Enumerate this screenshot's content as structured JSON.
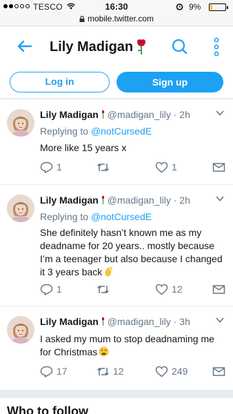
{
  "status_bar": {
    "carrier": "TESCO",
    "time": "16:30",
    "battery_percent": "9%",
    "battery_level": 0.09,
    "icons": [
      "signal-dots-icon",
      "wifi-icon",
      "alarm-icon",
      "battery-icon"
    ]
  },
  "browser": {
    "url": "mobile.twitter.com",
    "icon": "lock-icon"
  },
  "header": {
    "title": "Lily Madigan",
    "title_emoji": "rose-icon",
    "icons": [
      "back-arrow-icon",
      "search-icon",
      "more-vertical-icon"
    ]
  },
  "auth": {
    "login_label": "Log in",
    "signup_label": "Sign up"
  },
  "colors": {
    "accent": "#1da1f2",
    "text": "#14171a",
    "muted": "#657786",
    "divider": "#e6ecf0",
    "rose": "#c8102e"
  },
  "tweets": [
    {
      "name": "Lily Madigan",
      "handle": "@madigan_lily",
      "separator": "·",
      "time": "2h",
      "reply_prefix": "Replying to",
      "reply_to": "@notCursedE",
      "text": "More like 15 years x",
      "replies": "1",
      "retweets": "",
      "likes": "1"
    },
    {
      "name": "Lily Madigan",
      "handle": "@madigan_lily",
      "separator": "·",
      "time": "2h",
      "reply_prefix": "Replying to",
      "reply_to": "@notCursedE",
      "text": "She definitely hasn’t known me as my deadname for 20 years.. mostly because I’m a teenager but also because I changed it 3 years back",
      "text_emoji": "ok-hand-icon",
      "replies": "1",
      "retweets": "",
      "likes": "12"
    },
    {
      "name": "Lily Madigan",
      "handle": "@madigan_lily",
      "separator": "·",
      "time": "3h",
      "text": "I asked my mum to stop deadnaming me for Christmas",
      "text_emoji": "weary-face-icon",
      "replies": "17",
      "retweets": "12",
      "likes": "249"
    }
  ],
  "who_to_follow": {
    "title": "Who to follow"
  }
}
